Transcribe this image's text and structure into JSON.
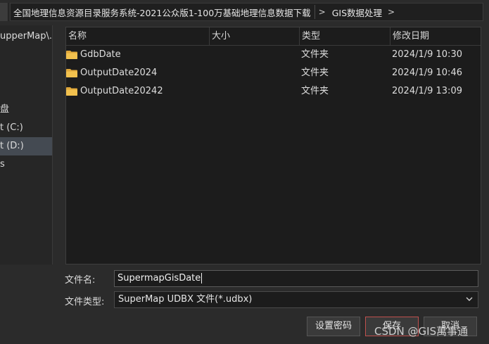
{
  "breadcrumb": {
    "items": [
      "全国地理信息资源目录服务系统-2021公众版1-100万基础地理信息数据下载",
      "GIS数据处理"
    ],
    "separator": ">"
  },
  "sidebar": {
    "items": [
      {
        "label": "upperMap\\...",
        "selected": false
      },
      {
        "label": "盘",
        "selected": false
      },
      {
        "label": "t (C:)",
        "selected": false
      },
      {
        "label": "t (D:)",
        "selected": true
      },
      {
        "label": "s",
        "selected": false
      }
    ]
  },
  "file_list": {
    "columns": [
      "名称",
      "大小",
      "类型",
      "修改日期"
    ],
    "rows": [
      {
        "name": "GdbDate",
        "size": "",
        "type": "文件夹",
        "date": "2024/1/9 10:30"
      },
      {
        "name": "OutputDate2024",
        "size": "",
        "type": "文件夹",
        "date": "2024/1/9 10:46"
      },
      {
        "name": "OutputDate20242",
        "size": "",
        "type": "文件夹",
        "date": "2024/1/9 13:09"
      }
    ]
  },
  "form": {
    "filename_label": "文件名:",
    "filename_value": "SupermapGisDate",
    "filetype_label": "文件类型:",
    "filetype_value": "SuperMap UDBX 文件(*.udbx)"
  },
  "buttons": {
    "set_password": "设置密码",
    "save": "保存",
    "cancel": "取消"
  },
  "watermark": "CSDN @GIS萬事通",
  "colors": {
    "folder": "#f2c14e",
    "save_border": "#c0504d",
    "selected_bg": "#444a52"
  }
}
